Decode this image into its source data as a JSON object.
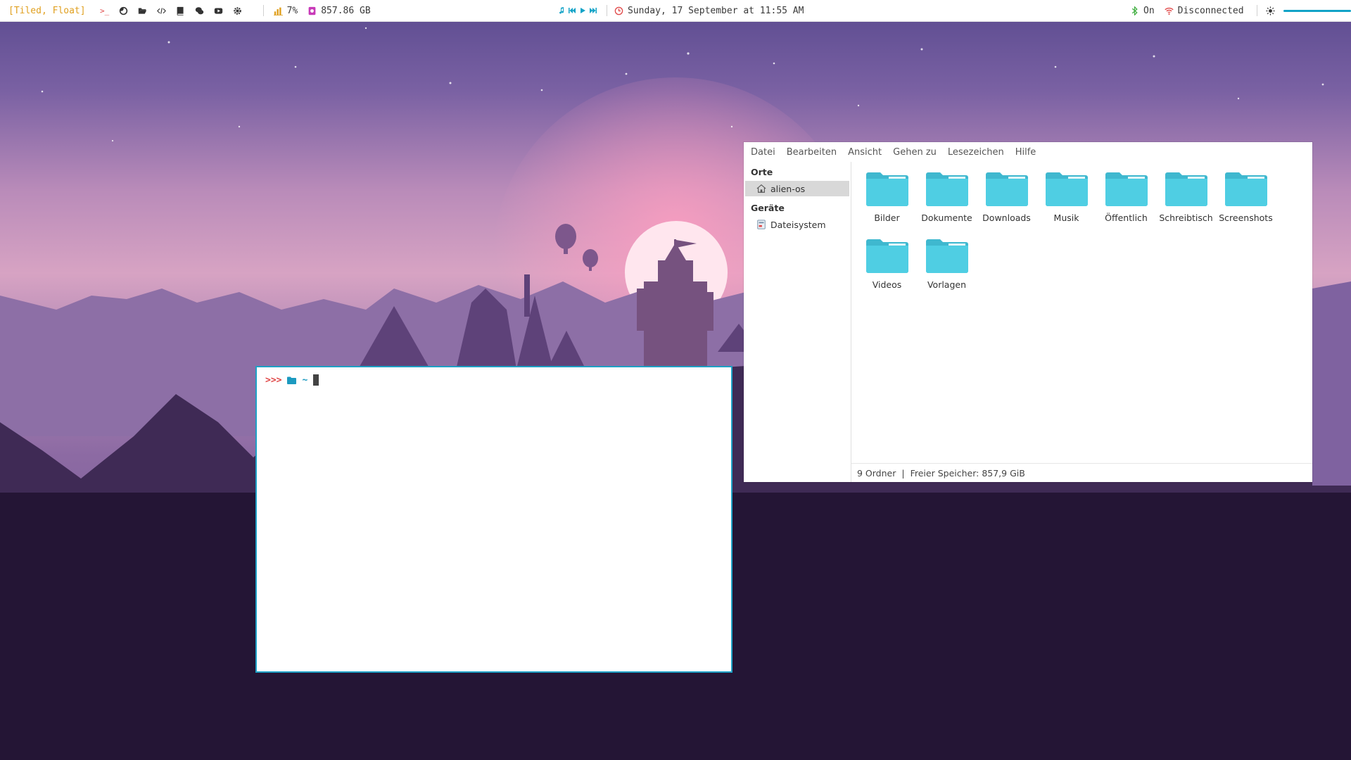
{
  "topbar": {
    "layout": "[Tiled, Float]",
    "launchers": [
      "terminal-icon",
      "firefox-icon",
      "folder-open-icon",
      "code-icon",
      "book-icon",
      "chat-icon",
      "youtube-icon",
      "settings-icon"
    ],
    "cpu": "7%",
    "disk": "857.86 GB",
    "datetime": "Sunday, 17 September at 11:55 AM",
    "bluetooth": "On",
    "network": "Disconnected",
    "brightness_level": 0.98,
    "accent": "#12a3c7"
  },
  "file_manager": {
    "menu": [
      "Datei",
      "Bearbeiten",
      "Ansicht",
      "Gehen zu",
      "Lesezeichen",
      "Hilfe"
    ],
    "sidebar": {
      "places_header": "Orte",
      "places": [
        {
          "label": "alien-os",
          "icon": "home-icon"
        }
      ],
      "devices_header": "Geräte",
      "devices": [
        {
          "label": "Dateisystem",
          "icon": "drive-icon"
        }
      ]
    },
    "folders": [
      "Bilder",
      "Dokumente",
      "Downloads",
      "Musik",
      "Öffentlich",
      "Schreibtisch",
      "Screenshots",
      "Videos",
      "Vorlagen"
    ],
    "folder_color": "#4fcee3",
    "status_count": "9 Ordner",
    "status_separator": "|",
    "status_free": "Freier Speicher: 857,9 GiB"
  },
  "terminal": {
    "prompt_chevrons": ">>>",
    "path": "~",
    "border_color": "#1ea1c6"
  }
}
